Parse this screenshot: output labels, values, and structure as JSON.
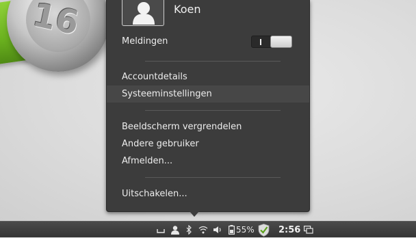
{
  "user": {
    "name": "Koen"
  },
  "notifications": {
    "label": "Meldingen",
    "enabled": false
  },
  "menu": {
    "account_details": "Accountdetails",
    "system_settings": "Systeeminstellingen",
    "lock_screen": "Beeldscherm vergrendelen",
    "switch_user": "Andere gebruiker",
    "log_out": "Afmelden...",
    "shut_down": "Uitschakelen..."
  },
  "panel": {
    "battery_percent": "55%",
    "clock": "2:56"
  },
  "wallpaper": {
    "logo_number": "16"
  }
}
